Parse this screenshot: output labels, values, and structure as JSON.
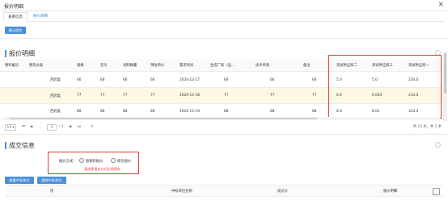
{
  "window": {
    "title": "报价明细"
  },
  "tabs": [
    {
      "label": "查看信息"
    },
    {
      "label": "报价明细"
    }
  ],
  "toolbar": {
    "confirm_label": "确认提交"
  },
  "quote_section": {
    "title": "报价明细"
  },
  "quote_table": {
    "columns": [
      "物料编号",
      "物资分类",
      "规格",
      "型号",
      "采购数量",
      "预估单价",
      "需求时间",
      "生成厂家（品...",
      "技术条款",
      "备注",
      "测试供应商二",
      "测试供应商三",
      "测试供应商一"
    ],
    "rows": [
      [
        "",
        "西药类",
        "66",
        "66",
        "66",
        "66",
        "2020-12-17",
        "66",
        "66",
        "66",
        "5.0",
        "5.0",
        "234.0"
      ],
      [
        "",
        "西药类",
        "77",
        "77",
        "77",
        "77",
        "2020-12-18",
        "77",
        "77",
        "77",
        "6.0",
        "6.003",
        "234.0"
      ],
      [
        "",
        "西药类",
        "88",
        "88",
        "88",
        "88",
        "2020-12-19",
        "88",
        "88",
        "88",
        "8.0",
        "8.01",
        "324.0"
      ]
    ]
  },
  "pager": {
    "page_size": "14",
    "current_page": "1",
    "total_pages_text": "/ 1",
    "summary": "共 14 条，共 1 条"
  },
  "deal_section": {
    "title": "成交信息"
  },
  "deal_form": {
    "method_label": "报价方式：",
    "option_single": "按物料报价",
    "option_package": "按包报价",
    "error_text": "请选择报价方式后再保存"
  },
  "deal_buttons": {
    "view_label": "查看中标单位",
    "delete_label": "删除中标单位"
  },
  "deal_table": {
    "columns": [
      "序",
      "中标单位名称",
      "成交价",
      "报价明细"
    ]
  }
}
